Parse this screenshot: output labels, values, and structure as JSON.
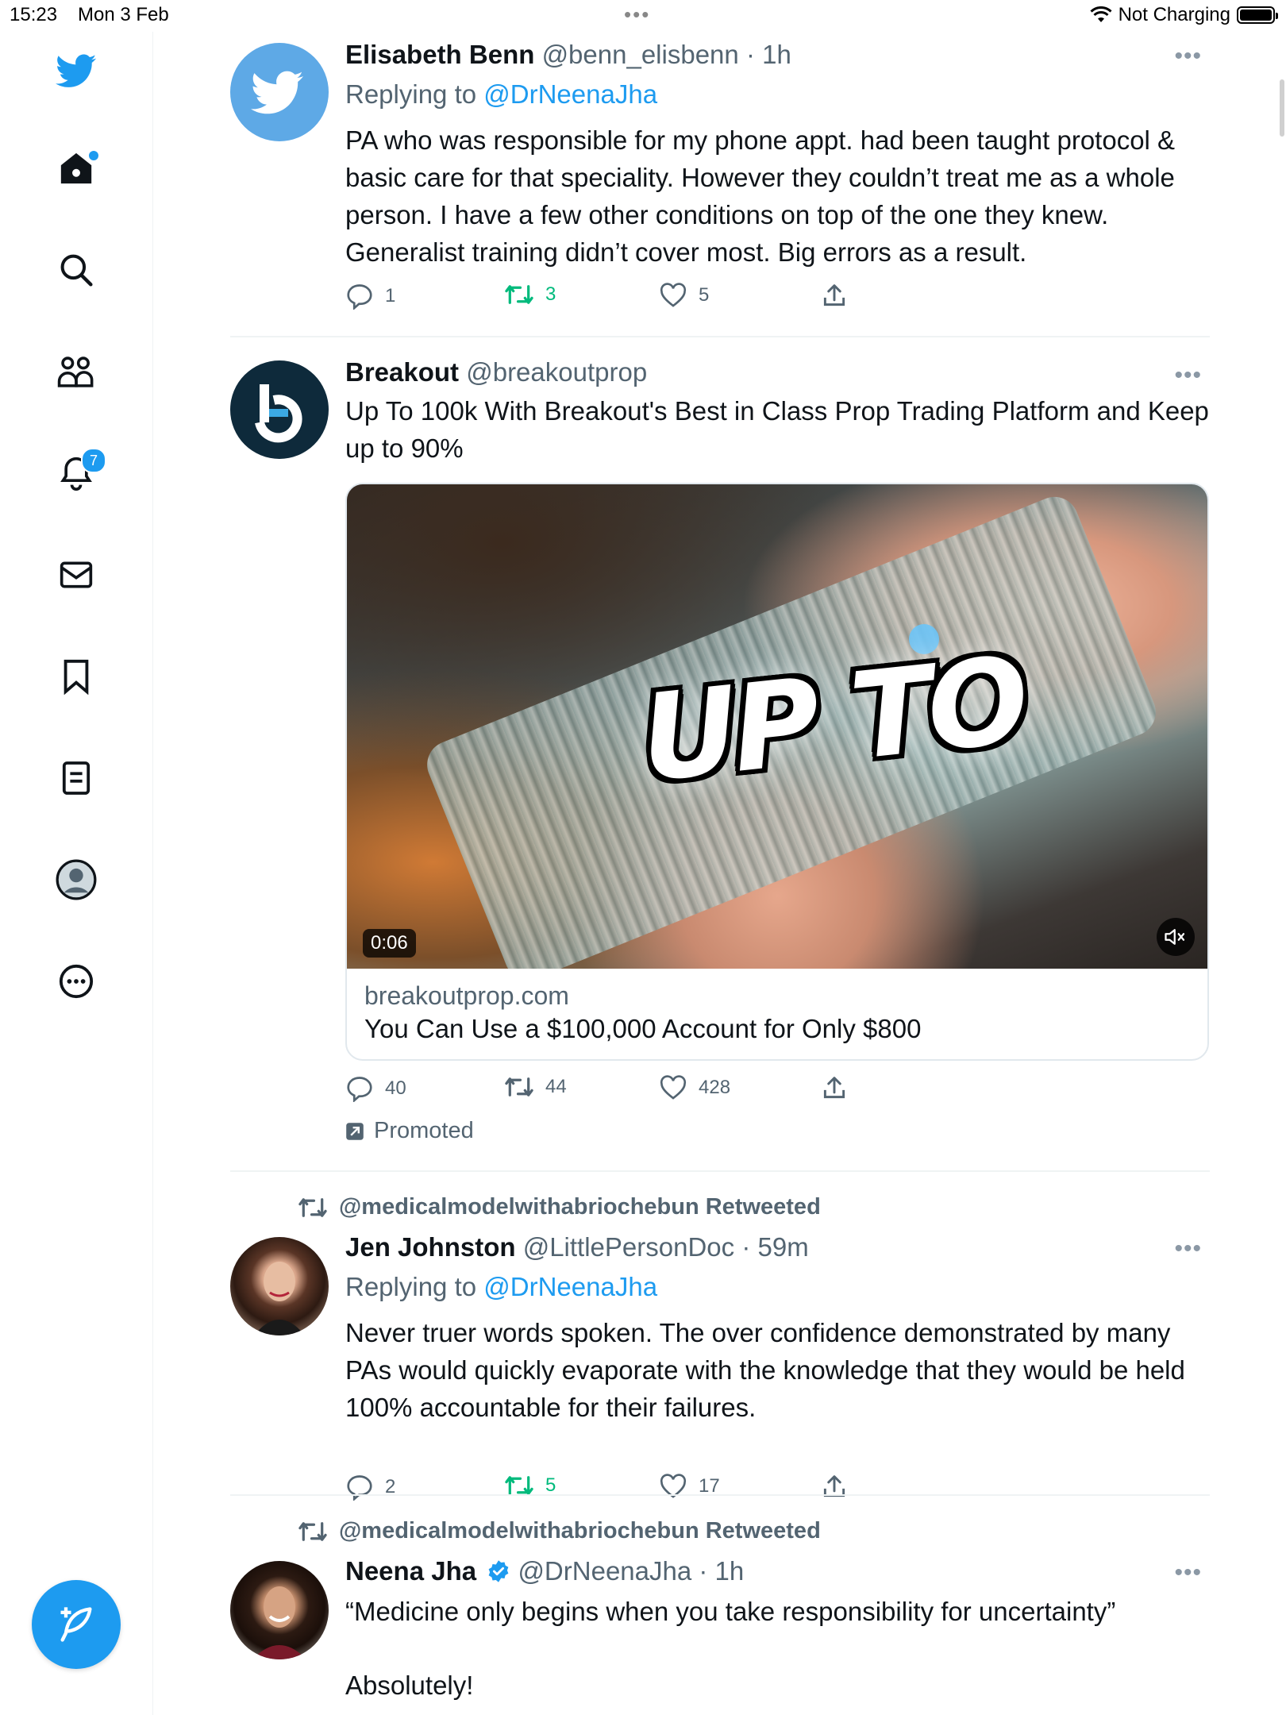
{
  "status_bar": {
    "time": "15:23",
    "date": "Mon 3 Feb",
    "charging": "Not Charging"
  },
  "sidebar": {
    "items": [
      {
        "name": "twitter-logo",
        "icon": "bird-icon"
      },
      {
        "name": "home",
        "icon": "home-icon",
        "dot": true
      },
      {
        "name": "explore",
        "icon": "search-icon"
      },
      {
        "name": "communities",
        "icon": "people-icon"
      },
      {
        "name": "notifications",
        "icon": "bell-icon",
        "badge": "7"
      },
      {
        "name": "messages",
        "icon": "envelope-icon"
      },
      {
        "name": "bookmarks",
        "icon": "bookmark-icon"
      },
      {
        "name": "lists",
        "icon": "list-icon"
      },
      {
        "name": "profile",
        "icon": "avatar-icon"
      },
      {
        "name": "more",
        "icon": "more-circle-icon"
      }
    ],
    "compose_icon": "compose-feather-icon"
  },
  "colors": {
    "accent": "#1d9bf0",
    "retweet_active": "#00ba7c",
    "secondary_text": "#536471"
  },
  "tweets": [
    {
      "name": "Elisabeth Benn",
      "handle": "@benn_elisbenn",
      "time": "· 1h",
      "replying_label": "Replying to",
      "replying_to": "@DrNeenaJha",
      "text": "PA who was responsible for my phone appt. had been taught protocol & basic care for that speciality.  However they couldn’t treat me as a whole person. I have a few other conditions on top of  the one they knew. Generalist training didn’t cover most. Big errors as a result.",
      "replies": "1",
      "retweets": "3",
      "likes": "5",
      "retweeted_by_me": true
    },
    {
      "name": "Breakout",
      "handle": "@breakoutprop",
      "text": "Up To 100k With Breakout's Best in Class Prop Trading Platform and Keep up to 90%",
      "media_overlay_text": "UP TO",
      "video_duration": "0:06",
      "card_domain": "breakoutprop.com",
      "card_title": "You Can Use a $100,000 Account for Only $800",
      "replies": "40",
      "retweets": "44",
      "likes": "428",
      "promoted_label": "Promoted"
    },
    {
      "retweeted_label": "@medicalmodelwithabriochebun Retweeted",
      "name": "Jen Johnston",
      "handle": "@LittlePersonDoc",
      "time": "· 59m",
      "replying_label": "Replying to",
      "replying_to": "@DrNeenaJha",
      "text": "Never truer words spoken. The over confidence demonstrated by many PAs would quickly evaporate with the knowledge that they would be held 100% accountable for their failures.",
      "replies": "2",
      "retweets": "5",
      "likes": "17",
      "retweeted_by_me": true
    },
    {
      "retweeted_label": "@medicalmodelwithabriochebun Retweeted",
      "name": "Neena Jha",
      "verified": true,
      "handle": "@DrNeenaJha",
      "time": "· 1h",
      "text_line1": "“Medicine only begins when you take responsibility for uncertainty”",
      "text_line2": "Absolutely!"
    }
  ]
}
